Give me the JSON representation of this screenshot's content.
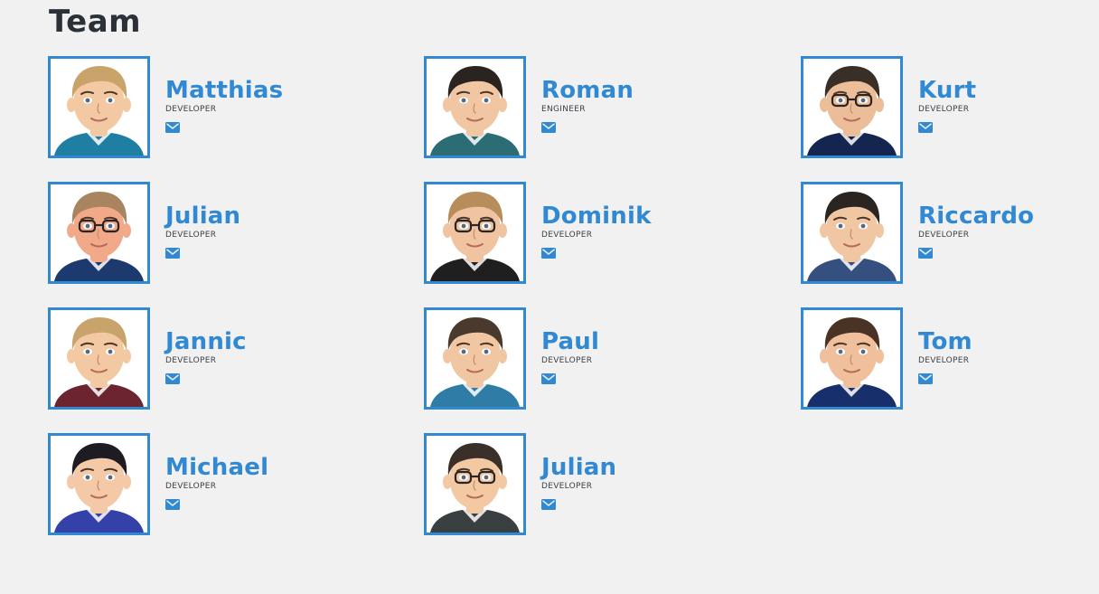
{
  "page": {
    "title": "Team"
  },
  "colors": {
    "accent": "#3189d3",
    "heading": "#2b3138",
    "background": "#f1f1f1"
  },
  "team": [
    {
      "name": "Matthias",
      "role": "DEVELOPER",
      "icon": "envelope-icon",
      "hair": "#c9a46a",
      "skin": "#f3c9a4",
      "shirt": "#1f7fa2",
      "glasses": false
    },
    {
      "name": "Roman",
      "role": "ENGINEER",
      "icon": "envelope-icon",
      "hair": "#2a2320",
      "skin": "#f1c6a2",
      "shirt": "#2c6c75",
      "glasses": false
    },
    {
      "name": "Kurt",
      "role": "DEVELOPER",
      "icon": "envelope-icon",
      "hair": "#3a2f27",
      "skin": "#ebbd98",
      "shirt": "#14254f",
      "glasses": true
    },
    {
      "name": "Julian",
      "role": "DEVELOPER",
      "icon": "envelope-icon",
      "hair": "#a98460",
      "skin": "#f2a98a",
      "shirt": "#1d3a6f",
      "glasses": true
    },
    {
      "name": "Dominik",
      "role": "DEVELOPER",
      "icon": "envelope-icon",
      "hair": "#b88d5c",
      "skin": "#f0c4a0",
      "shirt": "#1f1f1f",
      "glasses": true
    },
    {
      "name": "Riccardo",
      "role": "DEVELOPER",
      "icon": "envelope-icon",
      "hair": "#2b2521",
      "skin": "#f1c6a2",
      "shirt": "#35507f",
      "glasses": false
    },
    {
      "name": "Jannic",
      "role": "DEVELOPER",
      "icon": "envelope-icon",
      "hair": "#c8a46c",
      "skin": "#f3c9a4",
      "shirt": "#6b2430",
      "glasses": false
    },
    {
      "name": "Paul",
      "role": "DEVELOPER",
      "icon": "envelope-icon",
      "hair": "#4a3a2e",
      "skin": "#f1c6a2",
      "shirt": "#2f7da6",
      "glasses": false
    },
    {
      "name": "Tom",
      "role": "DEVELOPER",
      "icon": "envelope-icon",
      "hair": "#4a3324",
      "skin": "#f0c09c",
      "shirt": "#172f6b",
      "glasses": false
    },
    {
      "name": "Michael",
      "role": "DEVELOPER",
      "icon": "envelope-icon",
      "hair": "#1e1c22",
      "skin": "#f3c9a8",
      "shirt": "#3341a8",
      "glasses": false
    },
    {
      "name": "Julian",
      "role": "DEVELOPER",
      "icon": "envelope-icon",
      "hair": "#3a3029",
      "skin": "#f3c9a4",
      "shirt": "#3a3f41",
      "glasses": true
    }
  ]
}
